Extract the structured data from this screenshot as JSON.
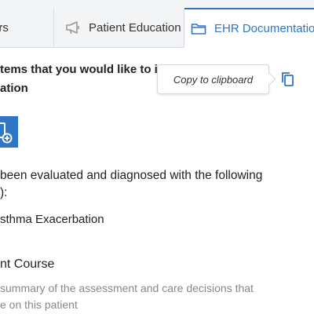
{
  "tabs": [
    {
      "label": "ers"
    },
    {
      "label": "Patient Education"
    },
    {
      "label": "EHR Documentation"
    }
  ],
  "heading": {
    "line1": "tems that you would like to include in",
    "line2": "ation"
  },
  "tooltip": {
    "text": "Copy to clipboard"
  },
  "body": {
    "paragraph_line1": " been evaluated and diagnosed with the following",
    "paragraph_line2": "):",
    "diagnosis": "sthma Exacerbation",
    "section_title": "nt Course",
    "description_line1": "summary of the assessment and care decisions that",
    "description_line2": "e on this patient"
  },
  "colors": {
    "accent": "#2f76c8",
    "muted_text": "#888888",
    "tab_bg": "#f3f4f6"
  }
}
